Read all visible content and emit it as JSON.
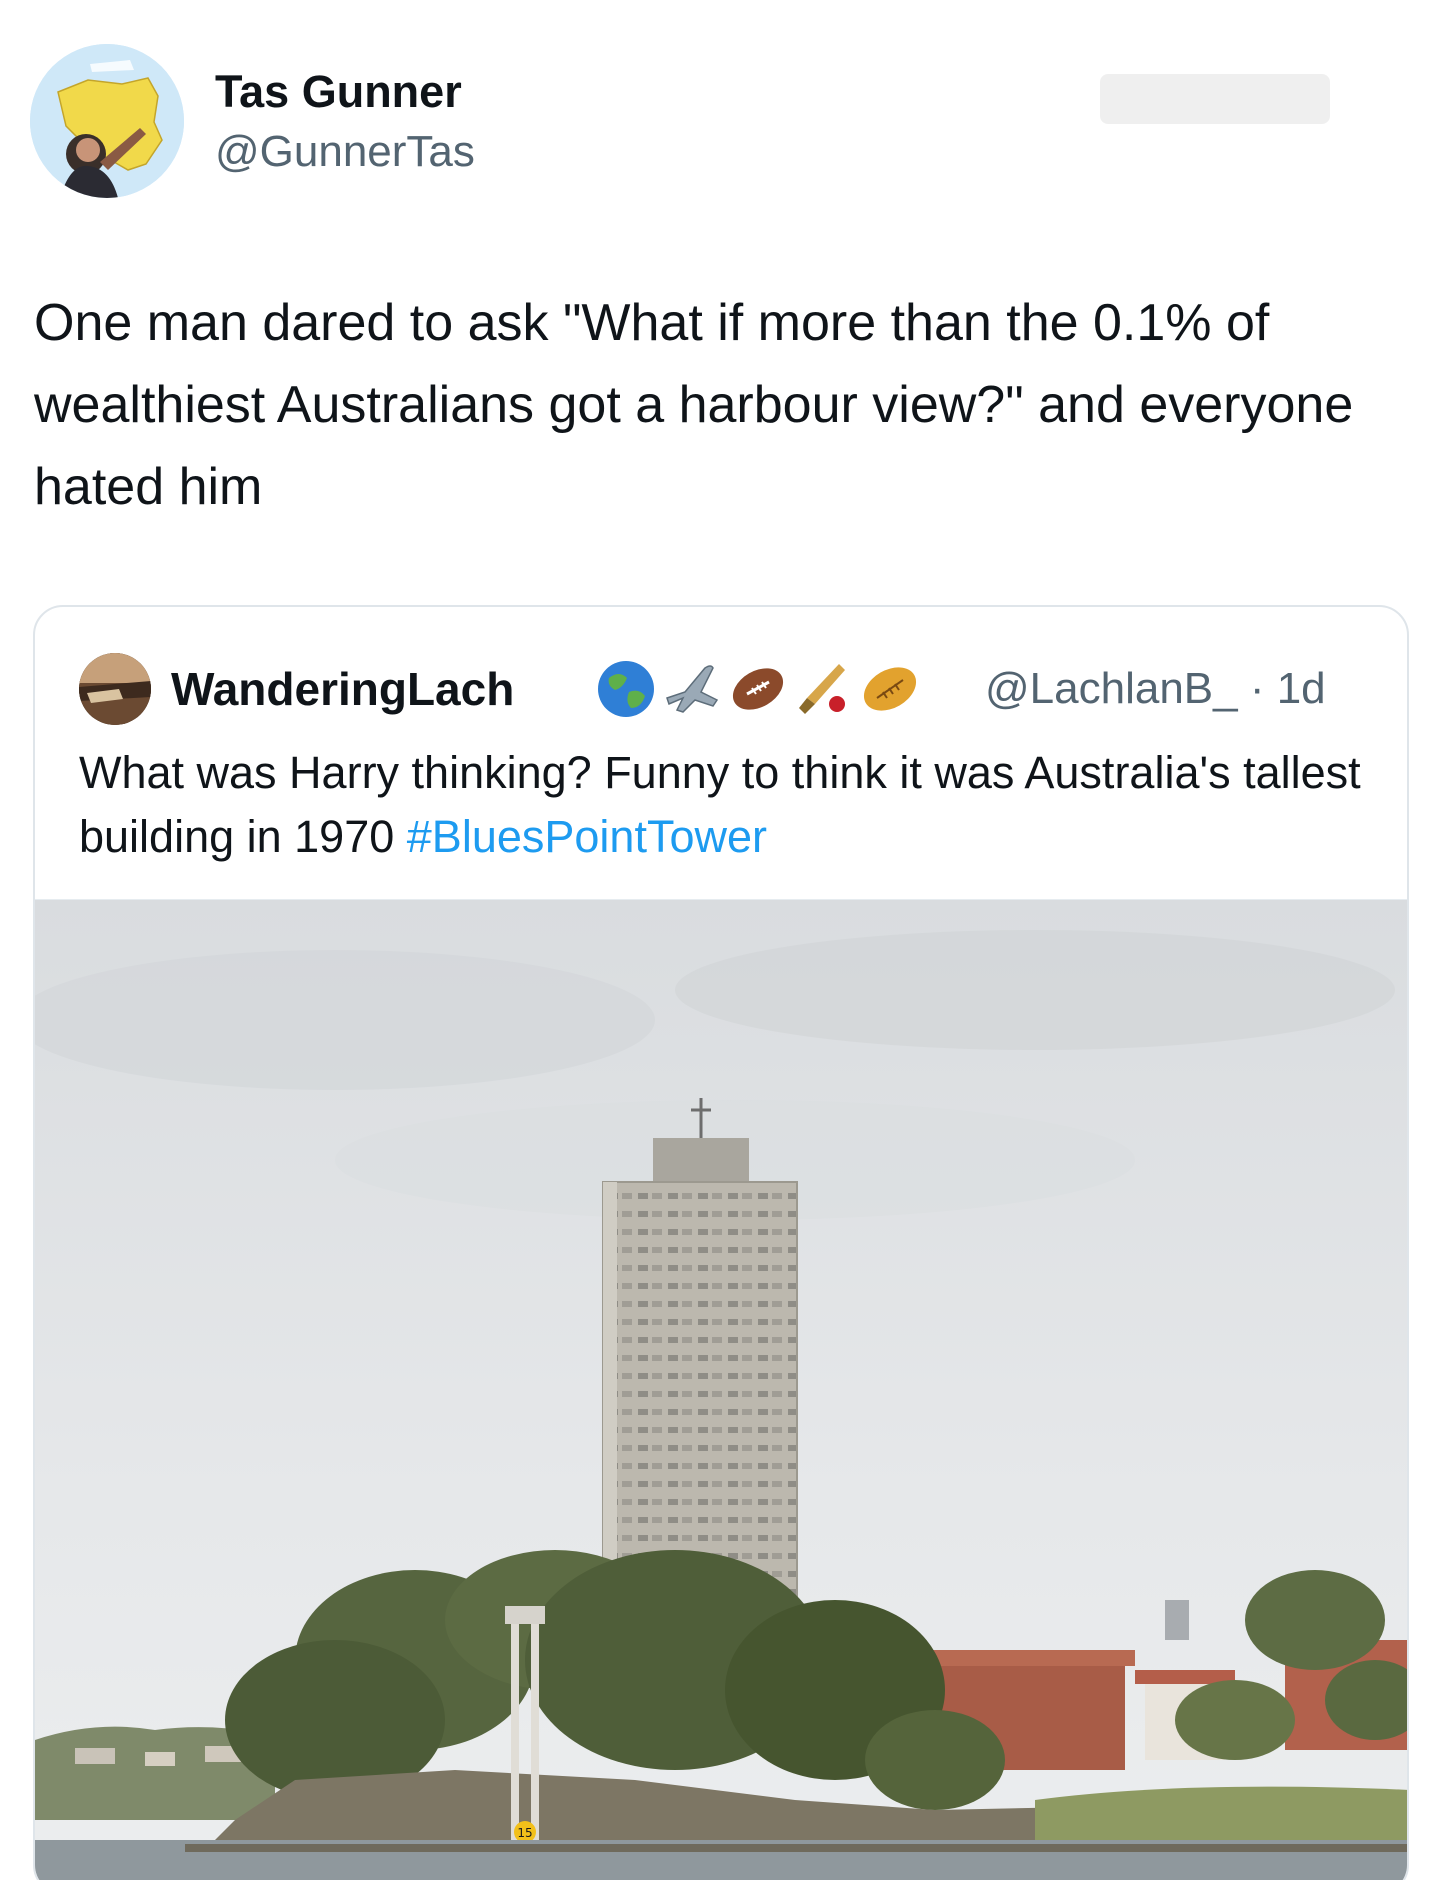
{
  "tweet": {
    "author": {
      "display_name": "Tas Gunner",
      "handle": "@GunnerTas"
    },
    "text": "One man dared to ask \"What if more than the 0.1% of wealthiest Australians got a harbour view?\" and everyone hated him"
  },
  "quoted_tweet": {
    "author": {
      "display_name": "WanderingLach",
      "handle": "@LachlanB_",
      "emoji_icons": [
        "globe-icon",
        "airplane-icon",
        "american-football-icon",
        "cricket-icon",
        "rugby-ball-icon"
      ]
    },
    "meta": "@LachlanB_ · 1d",
    "text": "What was Harry thinking? Funny to think it was Australia's tallest building in 1970 ",
    "hashtag": "#BluesPointTower",
    "image": {
      "sign_number": "15",
      "colors": {
        "sky": "#e4e6e8",
        "tower": "#b9b6ad",
        "trees": "#4e5e3a",
        "water": "#8e979c",
        "brick": "#a65b48"
      }
    }
  },
  "colors": {
    "text_primary": "#0f1419",
    "text_secondary": "#536471",
    "link": "#1d9bf0",
    "border": "#dfe5ea"
  }
}
